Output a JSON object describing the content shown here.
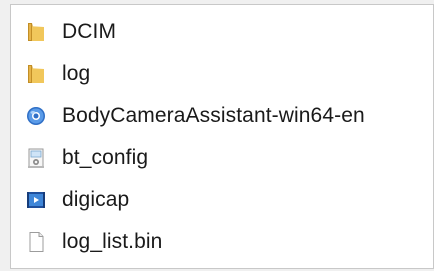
{
  "files": [
    {
      "name": "DCIM",
      "icon": "folder-icon"
    },
    {
      "name": "log",
      "icon": "folder-icon"
    },
    {
      "name": "BodyCameraAssistant-win64-en",
      "icon": "application-icon"
    },
    {
      "name": "bt_config",
      "icon": "config-file-icon"
    },
    {
      "name": "digicap",
      "icon": "video-file-icon"
    },
    {
      "name": "log_list.bin",
      "icon": "blank-file-icon"
    }
  ],
  "colors": {
    "folder": "#e8b94a",
    "app_blue": "#3a7fd5",
    "text": "#1a1a1a"
  }
}
